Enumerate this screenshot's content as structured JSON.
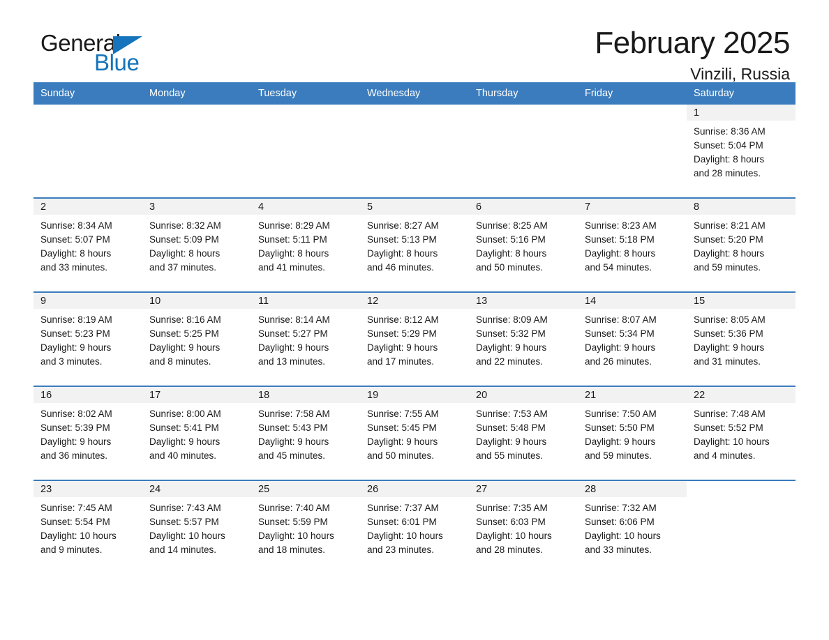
{
  "brand": {
    "name_part1": "General",
    "name_part2": "Blue",
    "accent_color": "#1574bb"
  },
  "header": {
    "month_title": "February 2025",
    "location": "Vinzili, Russia"
  },
  "theme": {
    "header_band": "#3a7cbe",
    "daynum_band": "#f2f2f2",
    "text": "#1a1a1a"
  },
  "calendar": {
    "weekday_headers": [
      "Sunday",
      "Monday",
      "Tuesday",
      "Wednesday",
      "Thursday",
      "Friday",
      "Saturday"
    ],
    "weeks": [
      [
        {
          "day": "",
          "blank": true
        },
        {
          "day": "",
          "blank": true
        },
        {
          "day": "",
          "blank": true
        },
        {
          "day": "",
          "blank": true
        },
        {
          "day": "",
          "blank": true
        },
        {
          "day": "",
          "blank": true
        },
        {
          "day": "1",
          "sunrise": "Sunrise: 8:36 AM",
          "sunset": "Sunset: 5:04 PM",
          "daylight_line1": "Daylight: 8 hours",
          "daylight_line2": "and 28 minutes."
        }
      ],
      [
        {
          "day": "2",
          "sunrise": "Sunrise: 8:34 AM",
          "sunset": "Sunset: 5:07 PM",
          "daylight_line1": "Daylight: 8 hours",
          "daylight_line2": "and 33 minutes."
        },
        {
          "day": "3",
          "sunrise": "Sunrise: 8:32 AM",
          "sunset": "Sunset: 5:09 PM",
          "daylight_line1": "Daylight: 8 hours",
          "daylight_line2": "and 37 minutes."
        },
        {
          "day": "4",
          "sunrise": "Sunrise: 8:29 AM",
          "sunset": "Sunset: 5:11 PM",
          "daylight_line1": "Daylight: 8 hours",
          "daylight_line2": "and 41 minutes."
        },
        {
          "day": "5",
          "sunrise": "Sunrise: 8:27 AM",
          "sunset": "Sunset: 5:13 PM",
          "daylight_line1": "Daylight: 8 hours",
          "daylight_line2": "and 46 minutes."
        },
        {
          "day": "6",
          "sunrise": "Sunrise: 8:25 AM",
          "sunset": "Sunset: 5:16 PM",
          "daylight_line1": "Daylight: 8 hours",
          "daylight_line2": "and 50 minutes."
        },
        {
          "day": "7",
          "sunrise": "Sunrise: 8:23 AM",
          "sunset": "Sunset: 5:18 PM",
          "daylight_line1": "Daylight: 8 hours",
          "daylight_line2": "and 54 minutes."
        },
        {
          "day": "8",
          "sunrise": "Sunrise: 8:21 AM",
          "sunset": "Sunset: 5:20 PM",
          "daylight_line1": "Daylight: 8 hours",
          "daylight_line2": "and 59 minutes."
        }
      ],
      [
        {
          "day": "9",
          "sunrise": "Sunrise: 8:19 AM",
          "sunset": "Sunset: 5:23 PM",
          "daylight_line1": "Daylight: 9 hours",
          "daylight_line2": "and 3 minutes."
        },
        {
          "day": "10",
          "sunrise": "Sunrise: 8:16 AM",
          "sunset": "Sunset: 5:25 PM",
          "daylight_line1": "Daylight: 9 hours",
          "daylight_line2": "and 8 minutes."
        },
        {
          "day": "11",
          "sunrise": "Sunrise: 8:14 AM",
          "sunset": "Sunset: 5:27 PM",
          "daylight_line1": "Daylight: 9 hours",
          "daylight_line2": "and 13 minutes."
        },
        {
          "day": "12",
          "sunrise": "Sunrise: 8:12 AM",
          "sunset": "Sunset: 5:29 PM",
          "daylight_line1": "Daylight: 9 hours",
          "daylight_line2": "and 17 minutes."
        },
        {
          "day": "13",
          "sunrise": "Sunrise: 8:09 AM",
          "sunset": "Sunset: 5:32 PM",
          "daylight_line1": "Daylight: 9 hours",
          "daylight_line2": "and 22 minutes."
        },
        {
          "day": "14",
          "sunrise": "Sunrise: 8:07 AM",
          "sunset": "Sunset: 5:34 PM",
          "daylight_line1": "Daylight: 9 hours",
          "daylight_line2": "and 26 minutes."
        },
        {
          "day": "15",
          "sunrise": "Sunrise: 8:05 AM",
          "sunset": "Sunset: 5:36 PM",
          "daylight_line1": "Daylight: 9 hours",
          "daylight_line2": "and 31 minutes."
        }
      ],
      [
        {
          "day": "16",
          "sunrise": "Sunrise: 8:02 AM",
          "sunset": "Sunset: 5:39 PM",
          "daylight_line1": "Daylight: 9 hours",
          "daylight_line2": "and 36 minutes."
        },
        {
          "day": "17",
          "sunrise": "Sunrise: 8:00 AM",
          "sunset": "Sunset: 5:41 PM",
          "daylight_line1": "Daylight: 9 hours",
          "daylight_line2": "and 40 minutes."
        },
        {
          "day": "18",
          "sunrise": "Sunrise: 7:58 AM",
          "sunset": "Sunset: 5:43 PM",
          "daylight_line1": "Daylight: 9 hours",
          "daylight_line2": "and 45 minutes."
        },
        {
          "day": "19",
          "sunrise": "Sunrise: 7:55 AM",
          "sunset": "Sunset: 5:45 PM",
          "daylight_line1": "Daylight: 9 hours",
          "daylight_line2": "and 50 minutes."
        },
        {
          "day": "20",
          "sunrise": "Sunrise: 7:53 AM",
          "sunset": "Sunset: 5:48 PM",
          "daylight_line1": "Daylight: 9 hours",
          "daylight_line2": "and 55 minutes."
        },
        {
          "day": "21",
          "sunrise": "Sunrise: 7:50 AM",
          "sunset": "Sunset: 5:50 PM",
          "daylight_line1": "Daylight: 9 hours",
          "daylight_line2": "and 59 minutes."
        },
        {
          "day": "22",
          "sunrise": "Sunrise: 7:48 AM",
          "sunset": "Sunset: 5:52 PM",
          "daylight_line1": "Daylight: 10 hours",
          "daylight_line2": "and 4 minutes."
        }
      ],
      [
        {
          "day": "23",
          "sunrise": "Sunrise: 7:45 AM",
          "sunset": "Sunset: 5:54 PM",
          "daylight_line1": "Daylight: 10 hours",
          "daylight_line2": "and 9 minutes."
        },
        {
          "day": "24",
          "sunrise": "Sunrise: 7:43 AM",
          "sunset": "Sunset: 5:57 PM",
          "daylight_line1": "Daylight: 10 hours",
          "daylight_line2": "and 14 minutes."
        },
        {
          "day": "25",
          "sunrise": "Sunrise: 7:40 AM",
          "sunset": "Sunset: 5:59 PM",
          "daylight_line1": "Daylight: 10 hours",
          "daylight_line2": "and 18 minutes."
        },
        {
          "day": "26",
          "sunrise": "Sunrise: 7:37 AM",
          "sunset": "Sunset: 6:01 PM",
          "daylight_line1": "Daylight: 10 hours",
          "daylight_line2": "and 23 minutes."
        },
        {
          "day": "27",
          "sunrise": "Sunrise: 7:35 AM",
          "sunset": "Sunset: 6:03 PM",
          "daylight_line1": "Daylight: 10 hours",
          "daylight_line2": "and 28 minutes."
        },
        {
          "day": "28",
          "sunrise": "Sunrise: 7:32 AM",
          "sunset": "Sunset: 6:06 PM",
          "daylight_line1": "Daylight: 10 hours",
          "daylight_line2": "and 33 minutes."
        },
        {
          "day": "",
          "blank": true
        }
      ]
    ]
  }
}
